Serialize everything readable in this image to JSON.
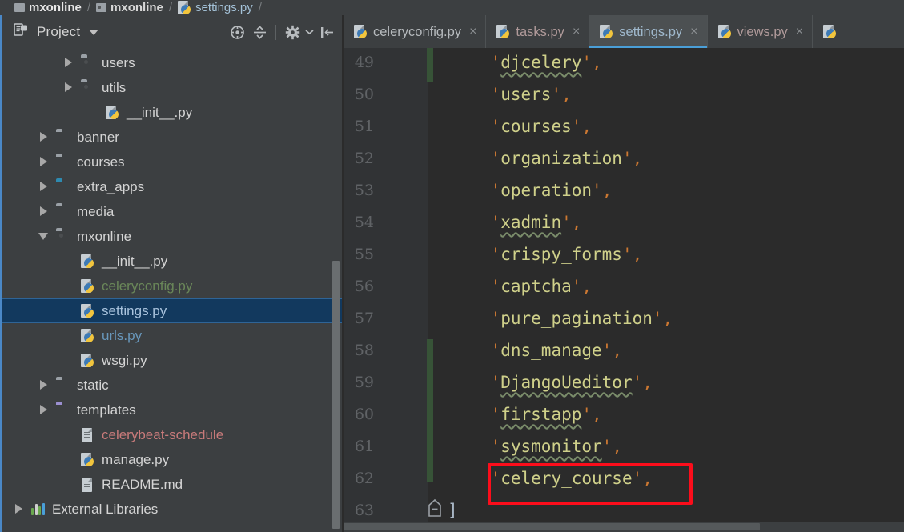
{
  "breadcrumb": {
    "items": [
      {
        "label": "mxonline",
        "icon": "folder-icon"
      },
      {
        "label": "mxonline",
        "icon": "source-folder-icon"
      },
      {
        "label": "settings.py",
        "icon": "python-file-icon"
      }
    ],
    "separator": "/"
  },
  "project_panel": {
    "title": "Project",
    "caret_icon": "chevron-down-icon",
    "tools": [
      {
        "name": "locate-in-tree-icon",
        "title": "Select Opened File"
      },
      {
        "name": "collapse-all-icon",
        "title": "Collapse All"
      },
      {
        "name": "settings-gear-icon",
        "title": "Settings"
      },
      {
        "name": "hide-panel-icon",
        "title": "Hide"
      }
    ],
    "tree": [
      {
        "label": "users",
        "icon": "source-folder-icon",
        "arrow": "closed",
        "indent": 2,
        "color": "#d4d4d4"
      },
      {
        "label": "utils",
        "icon": "source-folder-icon",
        "arrow": "closed",
        "indent": 2,
        "color": "#d4d4d4"
      },
      {
        "label": "__init__.py",
        "icon": "python-file-icon",
        "arrow": "none",
        "indent": 3,
        "color": "#d4d4d4"
      },
      {
        "label": "banner",
        "icon": "folder-icon",
        "arrow": "closed",
        "indent": 1,
        "color": "#d4d4d4"
      },
      {
        "label": "courses",
        "icon": "folder-icon",
        "arrow": "closed",
        "indent": 1,
        "color": "#d4d4d4"
      },
      {
        "label": "extra_apps",
        "icon": "folder-icon-teal",
        "arrow": "closed",
        "indent": 1,
        "color": "#d4d4d4"
      },
      {
        "label": "media",
        "icon": "folder-icon",
        "arrow": "closed",
        "indent": 1,
        "color": "#d4d4d4"
      },
      {
        "label": "mxonline",
        "icon": "source-folder-icon",
        "arrow": "open",
        "indent": 1,
        "color": "#d4d4d4"
      },
      {
        "label": "__init__.py",
        "icon": "python-file-icon",
        "arrow": "none",
        "indent": 2,
        "color": "#d4d4d4"
      },
      {
        "label": "celeryconfig.py",
        "icon": "python-file-icon",
        "arrow": "none",
        "indent": 2,
        "color": "#6a8759"
      },
      {
        "label": "settings.py",
        "icon": "python-file-icon",
        "arrow": "none",
        "indent": 2,
        "color": "#a9c3dd",
        "selected": true
      },
      {
        "label": "urls.py",
        "icon": "python-file-icon",
        "arrow": "none",
        "indent": 2,
        "color": "#6897bb"
      },
      {
        "label": "wsgi.py",
        "icon": "python-file-icon",
        "arrow": "none",
        "indent": 2,
        "color": "#d4d4d4"
      },
      {
        "label": "static",
        "icon": "folder-icon",
        "arrow": "closed",
        "indent": 1,
        "color": "#d4d4d4"
      },
      {
        "label": "templates",
        "icon": "folder-icon-purple",
        "arrow": "closed",
        "indent": 1,
        "color": "#d4d4d4"
      },
      {
        "label": "celerybeat-schedule",
        "icon": "text-file-icon",
        "arrow": "none",
        "indent": 2,
        "color": "#c87a7a"
      },
      {
        "label": "manage.py",
        "icon": "python-file-icon",
        "arrow": "none",
        "indent": 2,
        "color": "#d4d4d4"
      },
      {
        "label": "README.md",
        "icon": "text-file-icon",
        "arrow": "none",
        "indent": 2,
        "color": "#d4d4d4"
      },
      {
        "label": "External Libraries",
        "icon": "external-libraries-icon",
        "arrow": "closed",
        "indent": 0,
        "color": "#d4d4d4"
      }
    ]
  },
  "editor": {
    "tabs": [
      {
        "label": "celeryconfig.py",
        "icon": "python-file-icon",
        "active": false,
        "close_glyph": "×"
      },
      {
        "label": "tasks.py",
        "icon": "python-file-icon",
        "active": false,
        "modified": true,
        "close_glyph": "×"
      },
      {
        "label": "settings.py",
        "icon": "python-file-icon",
        "active": true,
        "close_glyph": "×"
      },
      {
        "label": "views.py",
        "icon": "python-file-icon",
        "active": false,
        "modified": true,
        "close_glyph": "×"
      },
      {
        "label": "",
        "icon": "python-file-icon",
        "active": false,
        "partial": true,
        "close_glyph": ""
      }
    ],
    "active_tab_underline_color": "#4a9fd8",
    "lines": [
      {
        "num": "49",
        "indent": 4,
        "quote": "'",
        "string": "djcelery",
        "comma": ",",
        "squiggly": true
      },
      {
        "num": "50",
        "indent": 4,
        "quote": "'",
        "string": "users",
        "comma": ",",
        "squiggly": false
      },
      {
        "num": "51",
        "indent": 4,
        "quote": "'",
        "string": "courses",
        "comma": ",",
        "squiggly": false
      },
      {
        "num": "52",
        "indent": 4,
        "quote": "'",
        "string": "organization",
        "comma": ",",
        "squiggly": false
      },
      {
        "num": "53",
        "indent": 4,
        "quote": "'",
        "string": "operation",
        "comma": ",",
        "squiggly": false
      },
      {
        "num": "54",
        "indent": 4,
        "quote": "'",
        "string": "xadmin",
        "comma": ",",
        "squiggly": true
      },
      {
        "num": "55",
        "indent": 4,
        "quote": "'",
        "string": "crispy_forms",
        "comma": ",",
        "squiggly": false
      },
      {
        "num": "56",
        "indent": 4,
        "quote": "'",
        "string": "captcha",
        "comma": ",",
        "squiggly": false
      },
      {
        "num": "57",
        "indent": 4,
        "quote": "'",
        "string": "pure_pagination",
        "comma": ",",
        "squiggly": false
      },
      {
        "num": "58",
        "indent": 4,
        "quote": "'",
        "string": "dns_manage",
        "comma": ",",
        "squiggly": false
      },
      {
        "num": "59",
        "indent": 4,
        "quote": "'",
        "string": "DjangoUeditor",
        "comma": ",",
        "squiggly": true
      },
      {
        "num": "60",
        "indent": 4,
        "quote": "'",
        "string": "firstapp",
        "comma": ",",
        "squiggly": true
      },
      {
        "num": "61",
        "indent": 4,
        "quote": "'",
        "string": "sysmonitor",
        "comma": ",",
        "squiggly": true
      },
      {
        "num": "62",
        "indent": 4,
        "quote": "'",
        "string": "celery_course",
        "comma": ",",
        "squiggly": false,
        "highlighted": true
      },
      {
        "num": "63",
        "indent": 0,
        "bracket": "]",
        "fold": "collapse-marker"
      }
    ],
    "highlight_color": "#fc0d1b",
    "vcs_marker_color": "#375337"
  }
}
